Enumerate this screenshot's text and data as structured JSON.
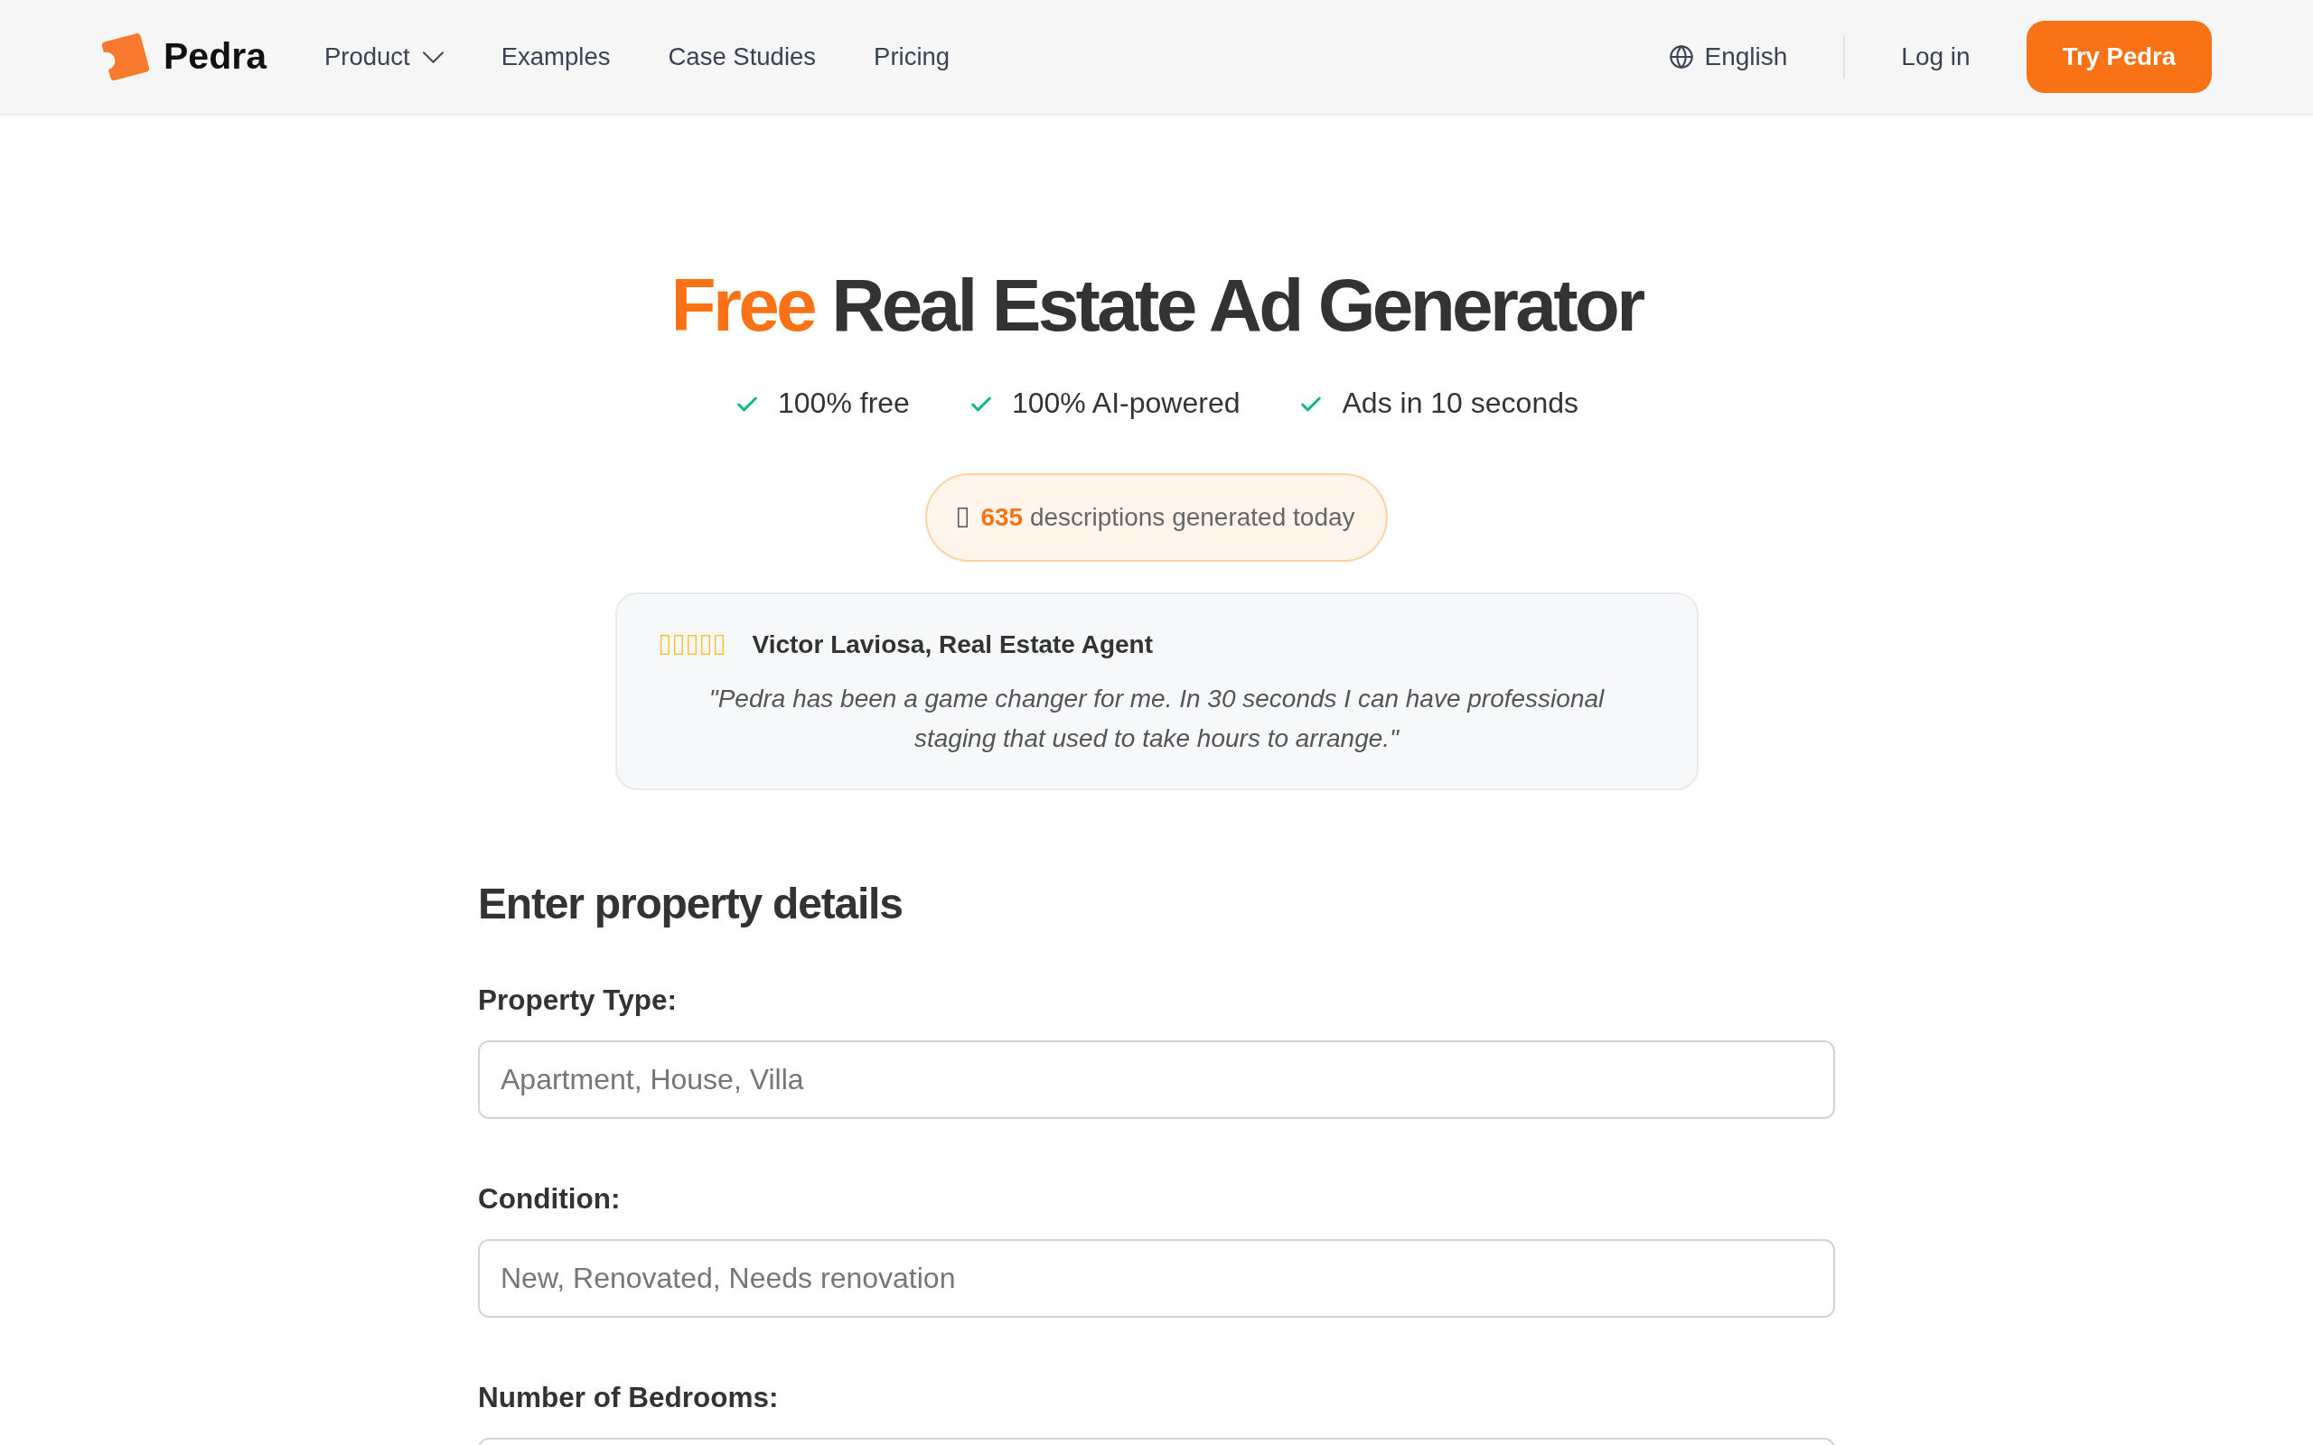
{
  "nav": {
    "logo": "Pedra",
    "links": [
      {
        "label": "Product",
        "kind": "dropdown"
      },
      {
        "label": "Examples",
        "kind": "link"
      },
      {
        "label": "Case Studies",
        "kind": "link"
      },
      {
        "label": "Pricing",
        "kind": "link"
      }
    ],
    "language": "English",
    "login": "Log in",
    "cta": "Try Pedra"
  },
  "hero": {
    "title": {
      "highlight": "Free",
      "text": "Real Estate Ad Generator"
    },
    "features": [
      "100% free",
      "100% AI-powered",
      "Ads in 10 seconds"
    ],
    "counter": "**635** descriptions generated today"
  },
  "testimonial": {
    "author": "Victor Laviosa, Real Estate Agent",
    "quote": "\"Pedra has been a game changer for me. In 30 seconds I can have professional staging that used to take hours to arrange.\""
  },
  "form": {
    "title": "Enter property details",
    "fields": [
      {
        "label": "Property Type:",
        "placeholder": "Apartment, House, Villa"
      },
      {
        "label": "Condition:",
        "placeholder": "New, Renovated, Needs renovation"
      },
      {
        "label": "Number of Bedrooms:"
      }
    ]
  }
}
